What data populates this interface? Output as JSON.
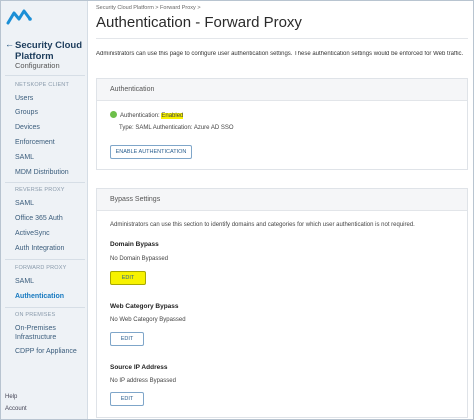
{
  "sidebar": {
    "back_arrow": "←",
    "platform_title": "Security Cloud Platform",
    "configuration": "Configuration",
    "sections": {
      "netskope_client": "NETSKOPE CLIENT",
      "reverse_proxy": "REVERSE PROXY",
      "forward_proxy": "FORWARD PROXY",
      "on_premises": "ON PREMISES"
    },
    "netskope_client_items": [
      "Users",
      "Groups",
      "Devices",
      "Enforcement",
      "SAML",
      "MDM Distribution"
    ],
    "reverse_proxy_items": [
      "SAML",
      "Office 365 Auth",
      "ActiveSync",
      "Auth Integration"
    ],
    "forward_proxy_items": [
      "SAML",
      "Authentication"
    ],
    "on_premises_items": [
      "On-Premises Infrastructure",
      "CDPP for Appliance"
    ],
    "help": "Help",
    "account": "Account"
  },
  "header": {
    "breadcrumb": "Security Cloud Platform > Forward Proxy >",
    "title": "Authentication - Forward Proxy"
  },
  "intro": "Administrators can use this page to configure user authentication settings. These authentication settings would be enforced for Web traffic.",
  "auth_card": {
    "heading": "Authentication",
    "status_label": "Authentication:",
    "status_value": "Enabled",
    "type_text": "Type: SAML Authentication: Azure AD SSO",
    "button": "ENABLE AUTHENTICATION"
  },
  "bypass_card": {
    "heading": "Bypass Settings",
    "description": "Administrators can use this section to identify domains and categories for which user authentication is not required.",
    "domain_title": "Domain Bypass",
    "domain_value": "No Domain Bypassed",
    "edit_label": "EDIT",
    "category_title": "Web Category Bypass",
    "category_value": "No Web Category Bypassed",
    "ip_title": "Source IP Address",
    "ip_value": "No IP address Bypassed"
  },
  "colors": {
    "accent": "#1679c0",
    "highlight": "#f7f200",
    "status_ok": "#6dbf4a"
  }
}
